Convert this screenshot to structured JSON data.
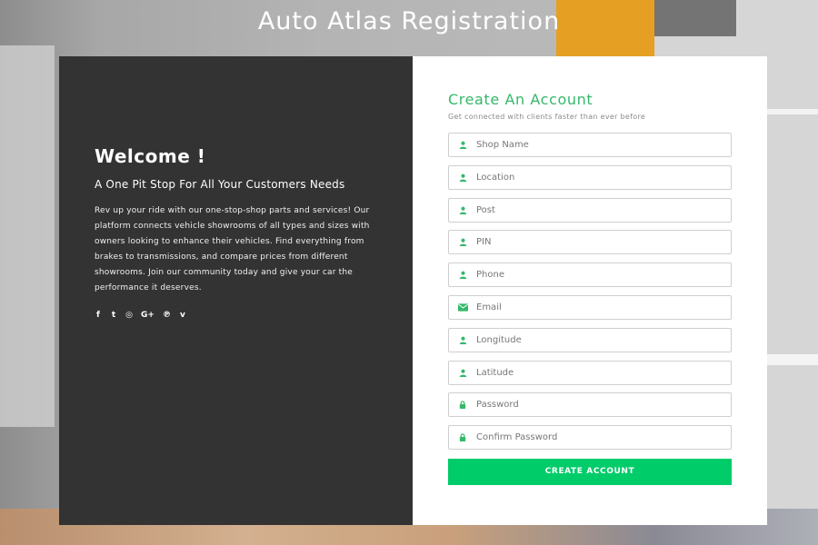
{
  "page": {
    "title": "Auto Atlas Registration"
  },
  "left": {
    "heading": "Welcome !",
    "subheading": "A One Pit Stop For All Your Customers Needs",
    "body_lines": [
      "Rev up your ride with our one-stop-shop parts and services! Our",
      "platform connects vehicle showrooms of all types and sizes with",
      "owners looking to enhance their vehicles. Find everything from",
      "brakes to transmissions, and compare prices from different",
      "showrooms. Join our community today and give your car the",
      "performance it deserves."
    ],
    "social": [
      {
        "name": "facebook-icon",
        "glyph": "f"
      },
      {
        "name": "twitter-icon",
        "glyph": "t"
      },
      {
        "name": "instagram-icon",
        "glyph": "◎"
      },
      {
        "name": "google-plus-icon",
        "glyph": "G+"
      },
      {
        "name": "pinterest-icon",
        "glyph": "℗"
      },
      {
        "name": "vimeo-icon",
        "glyph": "v"
      }
    ]
  },
  "form": {
    "title": "Create An Account",
    "subtitle": "Get connected with clients faster than ever before",
    "fields": [
      {
        "placeholder": "Shop Name",
        "icon": "user-icon"
      },
      {
        "placeholder": "Location",
        "icon": "user-icon"
      },
      {
        "placeholder": "Post",
        "icon": "user-icon"
      },
      {
        "placeholder": "PIN",
        "icon": "user-icon"
      },
      {
        "placeholder": "Phone",
        "icon": "user-icon"
      },
      {
        "placeholder": "Email",
        "icon": "envelope-icon"
      },
      {
        "placeholder": "Longitude",
        "icon": "user-icon"
      },
      {
        "placeholder": "Latitude",
        "icon": "user-icon"
      },
      {
        "placeholder": "Password",
        "icon": "lock-icon"
      },
      {
        "placeholder": "Confirm Password",
        "icon": "lock-icon"
      }
    ],
    "submit_label": "CREATE ACCOUNT"
  },
  "colors": {
    "accent": "#35b86a",
    "button": "#00cc6a",
    "panel_dark": "#333333"
  }
}
